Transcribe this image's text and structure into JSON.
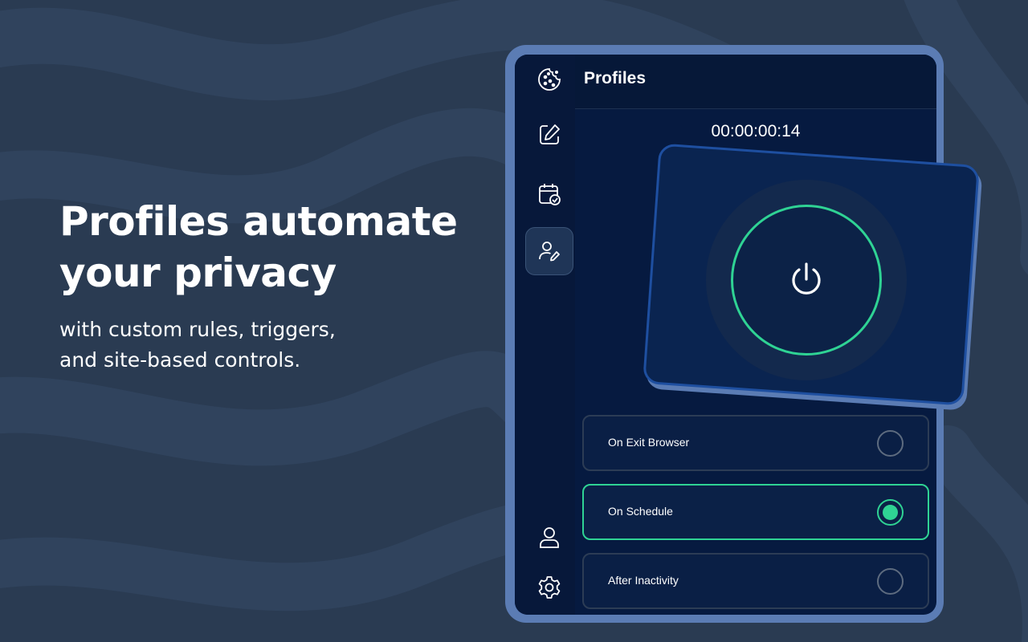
{
  "promo": {
    "headline_line1": "Profiles automate",
    "headline_line2": "your privacy",
    "subline_line1": "with custom rules, triggers,",
    "subline_line2": "and site-based controls."
  },
  "app": {
    "header": {
      "title": "Profiles"
    },
    "timer": "00:00:00:14",
    "sidebar": {
      "items": [
        {
          "icon": "cookie-icon",
          "active": false
        },
        {
          "icon": "edit-icon",
          "active": false
        },
        {
          "icon": "calendar-check-icon",
          "active": false
        },
        {
          "icon": "user-edit-icon",
          "active": true
        },
        {
          "icon": "user-icon",
          "active": false
        },
        {
          "icon": "gear-icon",
          "active": false
        }
      ]
    },
    "power": {
      "icon": "power-icon",
      "state": "on"
    },
    "options": [
      {
        "label": "On Exit Browser",
        "selected": false
      },
      {
        "label": "On Schedule",
        "selected": true
      },
      {
        "label": "After Inactivity",
        "selected": false
      }
    ]
  },
  "colors": {
    "background": "#2a3b52",
    "device_frame": "#5b7cb4",
    "screen": "#061a40",
    "accent_green": "#2fd394",
    "card_border": "#1e4fa0"
  }
}
